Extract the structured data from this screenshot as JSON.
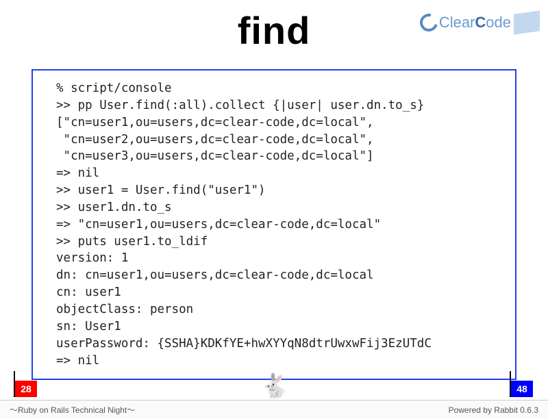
{
  "title": "find",
  "logo": {
    "brand": "ClearCode"
  },
  "code": "% script/console\n>> pp User.find(:all).collect {|user| user.dn.to_s}\n[\"cn=user1,ou=users,dc=clear-code,dc=local\",\n \"cn=user2,ou=users,dc=clear-code,dc=local\",\n \"cn=user3,ou=users,dc=clear-code,dc=local\"]\n=> nil\n>> user1 = User.find(\"user1\")\n>> user1.dn.to_s\n=> \"cn=user1,ou=users,dc=clear-code,dc=local\"\n>> puts user1.to_ldif\nversion: 1\ndn: cn=user1,ou=users,dc=clear-code,dc=local\ncn: user1\nobjectClass: person\nsn: User1\nuserPassword: {SSHA}KDKfYE+hwXYYqN8dtrUwxwFij3EzUTdC\n=> nil",
  "page": {
    "current": "28",
    "total": "48"
  },
  "footer": {
    "left": "〜Ruby on Rails Technical Night〜",
    "right": "Powered by Rabbit 0.6.3"
  }
}
